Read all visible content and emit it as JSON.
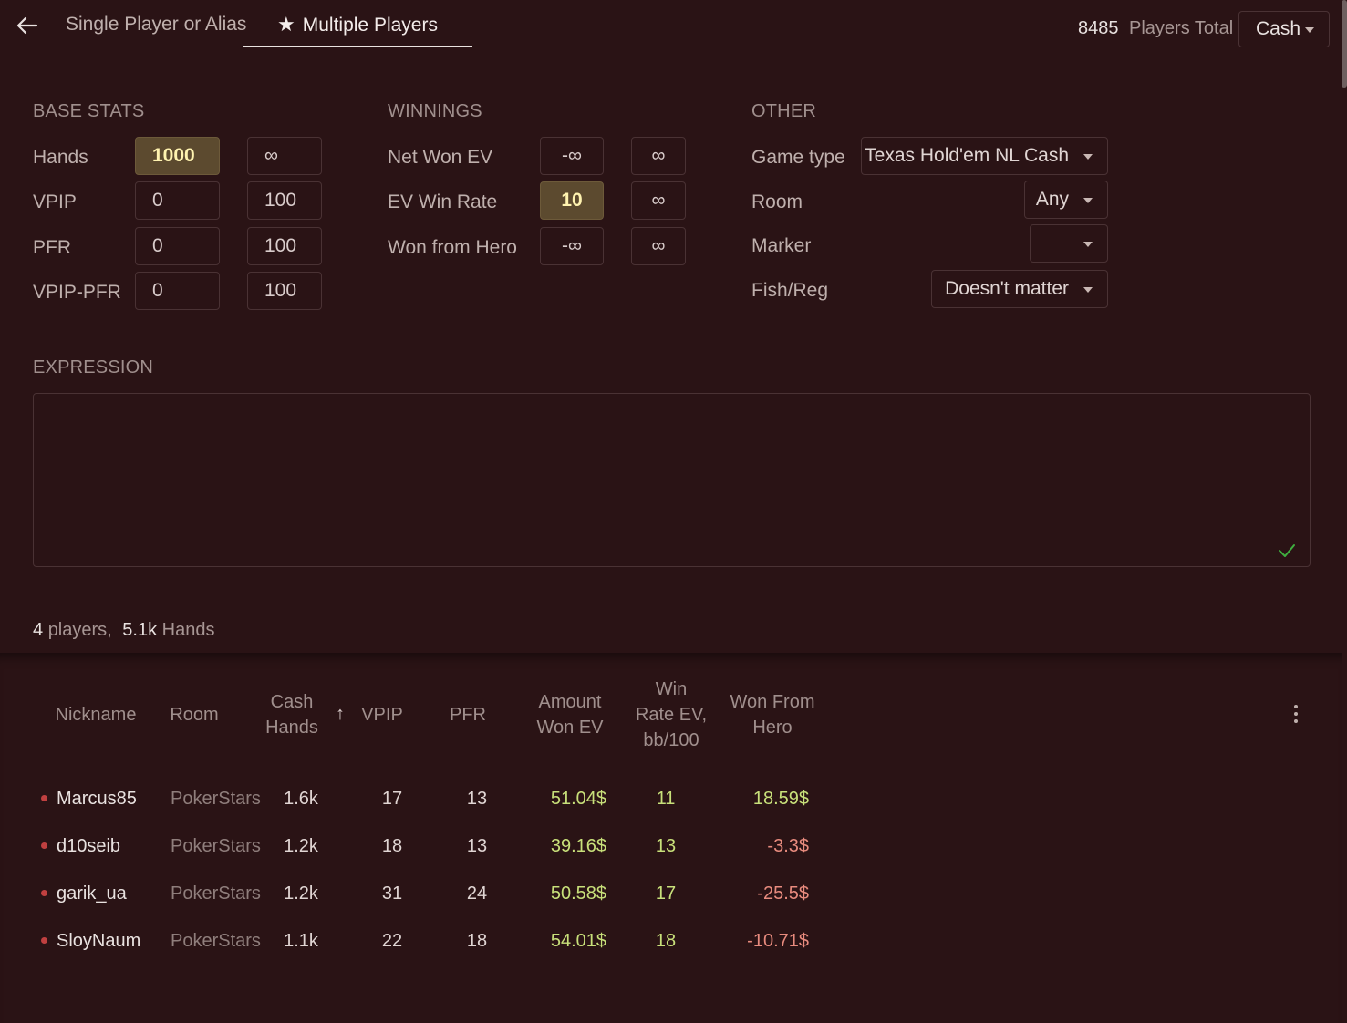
{
  "header": {
    "tabs": [
      {
        "label": "Single Player or Alias"
      },
      {
        "label": "Multiple Players"
      }
    ],
    "players_total_count": "8485",
    "players_total_label": "Players Total",
    "mode_select": "Cash"
  },
  "base_stats": {
    "title": "BASE STATS",
    "rows": [
      {
        "label": "Hands",
        "min": "1000",
        "max": "∞"
      },
      {
        "label": "VPIP",
        "min": "0",
        "max": "100"
      },
      {
        "label": "PFR",
        "min": "0",
        "max": "100"
      },
      {
        "label": "VPIP-PFR",
        "min": "0",
        "max": "100"
      }
    ]
  },
  "winnings": {
    "title": "WINNINGS",
    "rows": [
      {
        "label": "Net Won EV",
        "min": "-∞",
        "max": "∞"
      },
      {
        "label": "EV Win Rate",
        "min": "10",
        "max": "∞"
      },
      {
        "label": "Won from Hero",
        "min": "-∞",
        "max": "∞"
      }
    ]
  },
  "other": {
    "title": "OTHER",
    "rows": [
      {
        "label": "Game type",
        "value": "Texas Hold'em NL Cash"
      },
      {
        "label": "Room",
        "value": "Any"
      },
      {
        "label": "Marker",
        "value": ""
      },
      {
        "label": "Fish/Reg",
        "value": "Doesn't matter"
      }
    ]
  },
  "expression": {
    "title": "EXPRESSION",
    "value": ""
  },
  "summary": {
    "players_count": "4",
    "players_label": "players,",
    "hands_count": "5.1k",
    "hands_label": "Hands"
  },
  "table": {
    "columns": [
      "Nickname",
      "Room",
      "Cash Hands",
      "VPIP",
      "PFR",
      "Amount Won EV",
      "Win Rate EV, bb/100",
      "Won From Hero"
    ],
    "header_lines": {
      "cash_hands": [
        "Cash",
        "Hands"
      ],
      "amount_won": [
        "Amount",
        "Won EV"
      ],
      "win_rate": [
        "Win",
        "Rate EV,",
        "bb/100"
      ],
      "won_from_hero": [
        "Won From",
        "Hero"
      ]
    },
    "rows": [
      {
        "nickname": "Marcus85",
        "room": "PokerStars",
        "hands": "1.6k",
        "vpip": "17",
        "pfr": "13",
        "amount_won": "51.04$",
        "win_rate": "11",
        "won_from_hero": "18.59$"
      },
      {
        "nickname": "d10seib",
        "room": "PokerStars",
        "hands": "1.2k",
        "vpip": "18",
        "pfr": "13",
        "amount_won": "39.16$",
        "win_rate": "13",
        "won_from_hero": "-3.3$"
      },
      {
        "nickname": "garik_ua",
        "room": "PokerStars",
        "hands": "1.2k",
        "vpip": "31",
        "pfr": "24",
        "amount_won": "50.58$",
        "win_rate": "17",
        "won_from_hero": "-25.5$"
      },
      {
        "nickname": "SloyNaum",
        "room": "PokerStars",
        "hands": "1.1k",
        "vpip": "22",
        "pfr": "18",
        "amount_won": "54.01$",
        "win_rate": "18",
        "won_from_hero": "-10.71$"
      }
    ]
  },
  "colors": {
    "background": "#2a1315",
    "highlight_fill": "#5c4a2f",
    "positive": "#c8e07a",
    "negative": "#e88b7e",
    "status_dot": "#c04040"
  }
}
